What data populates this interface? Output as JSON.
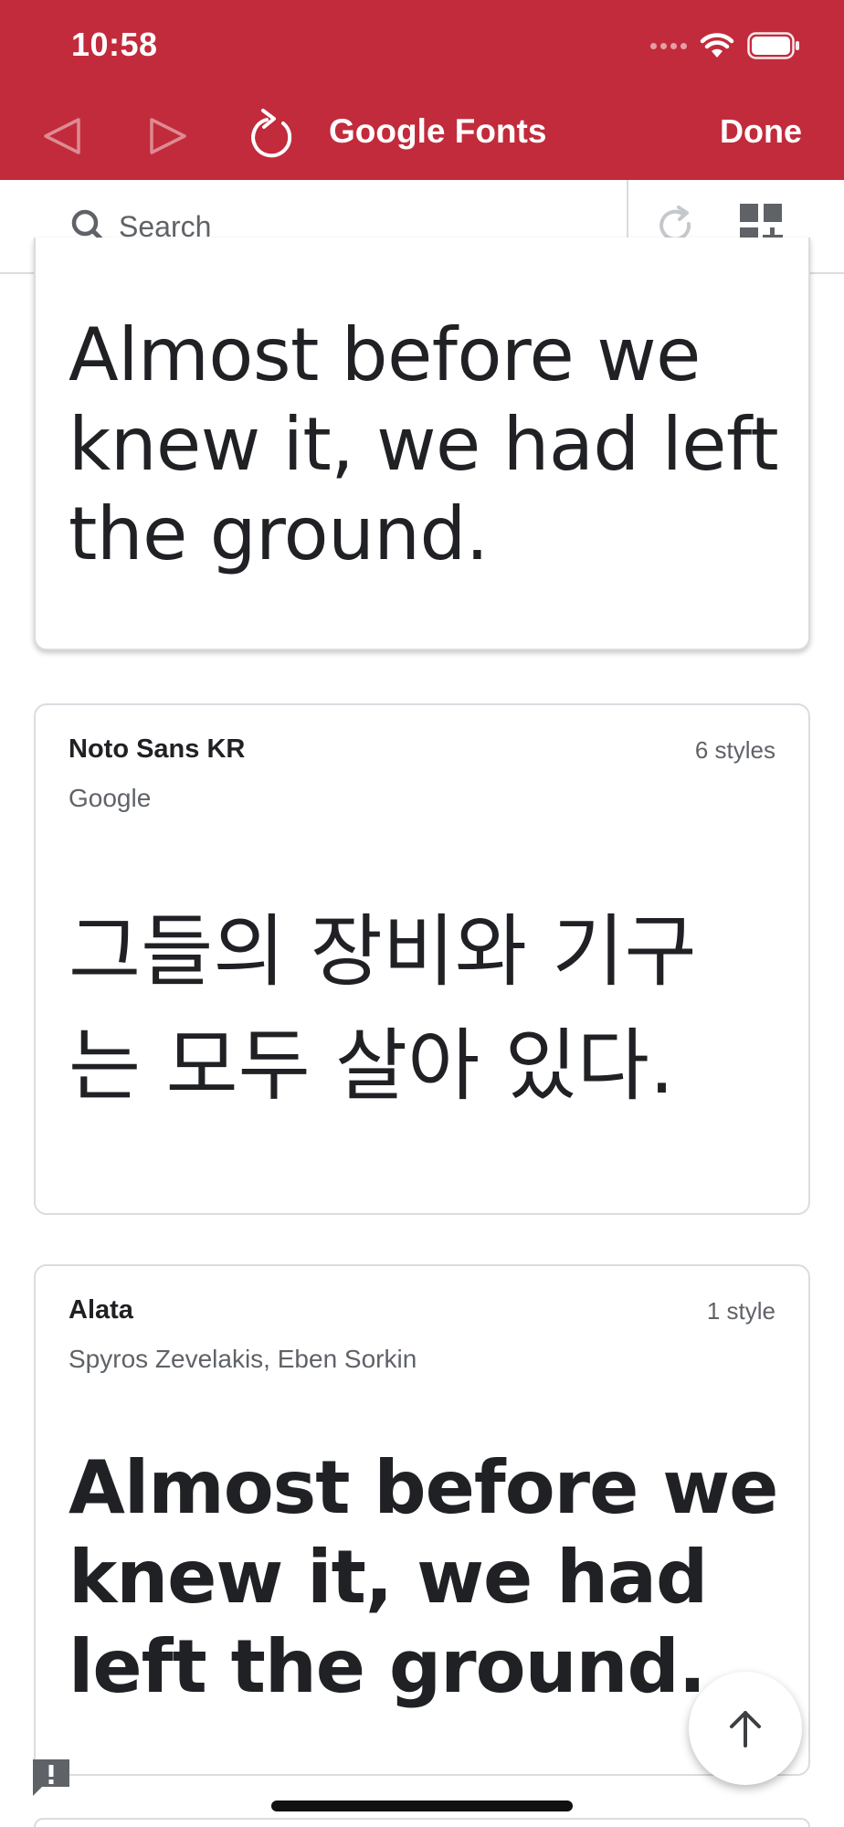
{
  "status_bar": {
    "time": "10:58"
  },
  "header": {
    "title": "Google Fonts",
    "done_label": "Done",
    "background_color": "#c22b3b"
  },
  "search": {
    "placeholder": "Search",
    "value": ""
  },
  "cards": [
    {
      "sample_lines": [
        "Almost before we",
        "knew it, we had left",
        "the ground."
      ]
    },
    {
      "family": "Noto Sans KR",
      "designer": "Google",
      "styles": "6 styles",
      "sample_lines": [
        "그들의 장비와 기구",
        "는 모두 살아 있다."
      ]
    },
    {
      "family": "Alata",
      "designer": "Spyros Zevelakis, Eben Sorkin",
      "styles": "1 style",
      "sample_lines": [
        "Almost before we",
        "knew it, we had",
        "left the ground."
      ]
    }
  ],
  "icons": {
    "back": "back-icon",
    "forward": "forward-icon",
    "reload": "reload-icon",
    "search": "search-icon",
    "refresh": "refresh-icon",
    "grid_add": "grid-add-icon",
    "scroll_top": "arrow-up-icon",
    "feedback": "feedback-icon"
  }
}
